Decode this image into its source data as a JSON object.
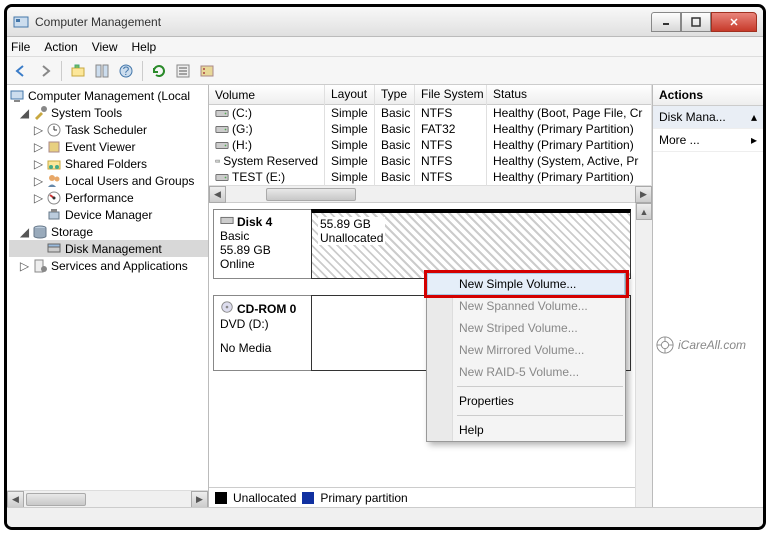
{
  "window": {
    "title": "Computer Management"
  },
  "menu": {
    "file": "File",
    "action": "Action",
    "view": "View",
    "help": "Help"
  },
  "tree": {
    "root": "Computer Management (Local",
    "system_tools": "System Tools",
    "task_scheduler": "Task Scheduler",
    "event_viewer": "Event Viewer",
    "shared_folders": "Shared Folders",
    "local_users": "Local Users and Groups",
    "performance": "Performance",
    "device_manager": "Device Manager",
    "storage": "Storage",
    "disk_management": "Disk Management",
    "services": "Services and Applications"
  },
  "columns": {
    "volume": "Volume",
    "layout": "Layout",
    "type": "Type",
    "fs": "File System",
    "status": "Status"
  },
  "volumes": [
    {
      "name": "(C:)",
      "layout": "Simple",
      "type": "Basic",
      "fs": "NTFS",
      "status": "Healthy (Boot, Page File, Cr"
    },
    {
      "name": "(G:)",
      "layout": "Simple",
      "type": "Basic",
      "fs": "FAT32",
      "status": "Healthy (Primary Partition)"
    },
    {
      "name": "(H:)",
      "layout": "Simple",
      "type": "Basic",
      "fs": "NTFS",
      "status": "Healthy (Primary Partition)"
    },
    {
      "name": "System Reserved",
      "layout": "Simple",
      "type": "Basic",
      "fs": "NTFS",
      "status": "Healthy (System, Active, Pr"
    },
    {
      "name": "TEST (E:)",
      "layout": "Simple",
      "type": "Basic",
      "fs": "NTFS",
      "status": "Healthy (Primary Partition)"
    }
  ],
  "disk4": {
    "name": "Disk 4",
    "type": "Basic",
    "size": "55.89 GB",
    "status": "Online",
    "part_size": "55.89 GB",
    "part_state": "Unallocated"
  },
  "cdrom": {
    "name": "CD-ROM 0",
    "label": "DVD (D:)",
    "status": "No Media"
  },
  "legend": {
    "unallocated": "Unallocated",
    "primary": "Primary partition"
  },
  "actions": {
    "header": "Actions",
    "disk_mgmt": "Disk Mana...",
    "more": "More ..."
  },
  "context": {
    "new_simple": "New Simple Volume...",
    "new_spanned": "New Spanned Volume...",
    "new_striped": "New Striped Volume...",
    "new_mirrored": "New Mirrored Volume...",
    "new_raid5": "New RAID-5 Volume...",
    "properties": "Properties",
    "help": "Help"
  },
  "watermark": "iCareAll.com"
}
